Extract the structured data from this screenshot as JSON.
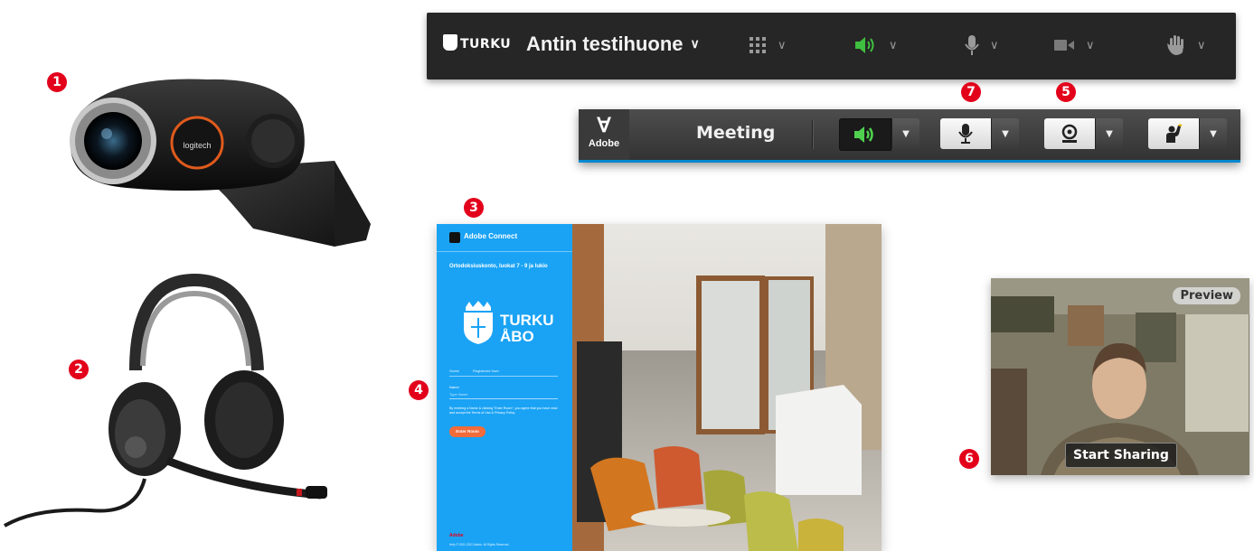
{
  "topbar": {
    "logo_text": "TURKU",
    "room_name": "Antin testihuone",
    "buttons": [
      {
        "name": "apps-grid-icon"
      },
      {
        "name": "speaker-icon",
        "color": "#3fbf3f"
      },
      {
        "name": "microphone-icon"
      },
      {
        "name": "camera-icon"
      },
      {
        "name": "raise-hand-icon"
      }
    ]
  },
  "classic_bar": {
    "logo_text": "Adobe",
    "title": "Meeting",
    "dropdown_glyph": "▼"
  },
  "callouts": {
    "c1": "1",
    "c2": "2",
    "c3": "3",
    "c4": "4",
    "c5": "5",
    "c6": "6",
    "c7": "7"
  },
  "login": {
    "app_name": "Adobe Connect",
    "room_title": "Ortodoksiuskonto, luokat 7 - 9 ja lukio",
    "city_line1": "TURKU",
    "city_line2": "ÅBO",
    "tab_guest": "Guest",
    "tab_registered": "Registered User",
    "name_label": "Name",
    "name_placeholder": "Type Name",
    "terms_text": "By entering a Name & clicking \"Enter Room\", you agree that you have read and accept the Terms of Use & Privacy Policy",
    "enter_button": "Enter Room",
    "footer_brand": "Adobe",
    "footer_copyright": "Help © 2001-2022 Adobe. All Rights Reserved."
  },
  "preview": {
    "badge": "Preview",
    "share_button": "Start Sharing"
  },
  "colors": {
    "callout": "#e3001b",
    "login_blue": "#1aa3f5",
    "speaker_active": "#3fbf3f",
    "enter_button": "#f26b3a"
  }
}
